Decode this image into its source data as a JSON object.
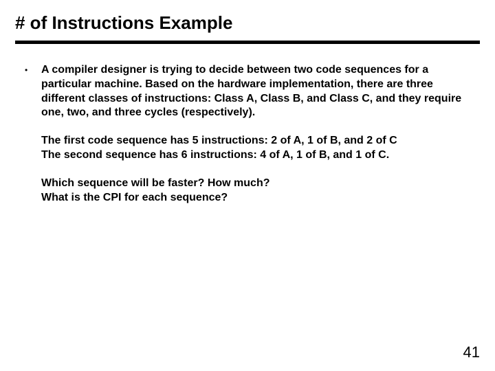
{
  "title": "# of Instructions Example",
  "bullet": {
    "marker": "•",
    "p1": "A compiler designer is trying to decide between two code sequences for a particular machine.  Based on the hardware implementation, there are three different classes of instructions:  Class A, Class B, and Class C, and they require one, two, and three cycles (respectively).",
    "p2a": "The first code sequence has 5 instructions:   2 of A, 1 of B, and 2 of C",
    "p2b": "The second sequence has 6 instructions:  4 of A, 1 of B, and 1 of C.",
    "p3a": "Which sequence will be faster?  How much?",
    "p3b": "What is the CPI for each sequence?"
  },
  "page_number": "41"
}
